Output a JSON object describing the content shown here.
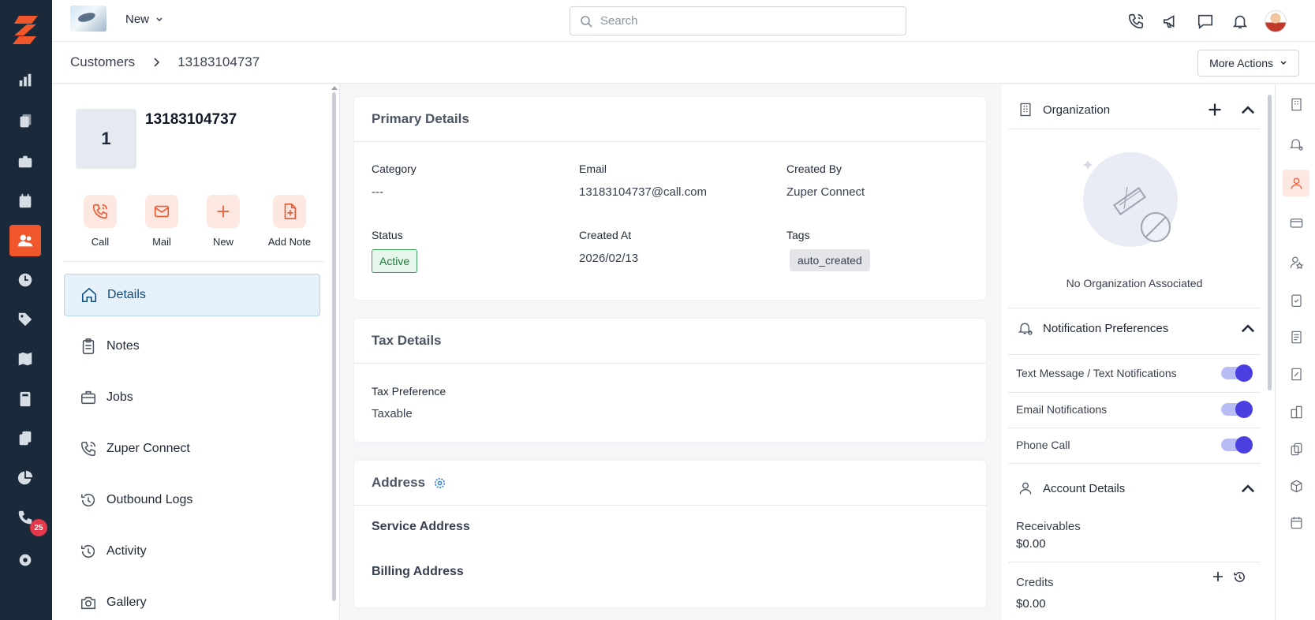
{
  "colors": {
    "rail_bg": "#1b2a3a",
    "accent": "#f1572c",
    "toggle_on": "#4a3fe0",
    "active_nav": "#e7f1fb"
  },
  "topbar": {
    "new_label": "New",
    "search_placeholder": "Search"
  },
  "breadcrumb": {
    "root": "Customers",
    "current": "13183104737"
  },
  "more_actions": "More Actions",
  "customer": {
    "initial": "1",
    "name": "13183104737"
  },
  "quick_actions": [
    "Call",
    "Mail",
    "New",
    "Add Note"
  ],
  "nav": [
    "Details",
    "Notes",
    "Jobs",
    "Zuper Connect",
    "Outbound Logs",
    "Activity",
    "Gallery"
  ],
  "rail": {
    "badge": "25"
  },
  "primary": {
    "title": "Primary Details",
    "category_label": "Category",
    "category": "---",
    "email_label": "Email",
    "email": "13183104737@call.com",
    "created_by_label": "Created By",
    "created_by": "Zuper Connect",
    "status_label": "Status",
    "status": "Active",
    "created_at_label": "Created At",
    "created_at": "2026/02/13",
    "tags_label": "Tags",
    "tag": "auto_created"
  },
  "tax": {
    "title": "Tax Details",
    "pref_label": "Tax Preference",
    "pref": "Taxable"
  },
  "address": {
    "title": "Address",
    "service": "Service Address",
    "billing": "Billing Address"
  },
  "organization": {
    "title": "Organization",
    "empty": "No Organization Associated"
  },
  "notifications": {
    "title": "Notification Preferences",
    "items": [
      "Text Message / Text Notifications",
      "Email Notifications",
      "Phone Call"
    ]
  },
  "account": {
    "title": "Account Details",
    "receivables_label": "Receivables",
    "receivables": "$0.00",
    "credits_label": "Credits",
    "credits": "$0.00"
  }
}
